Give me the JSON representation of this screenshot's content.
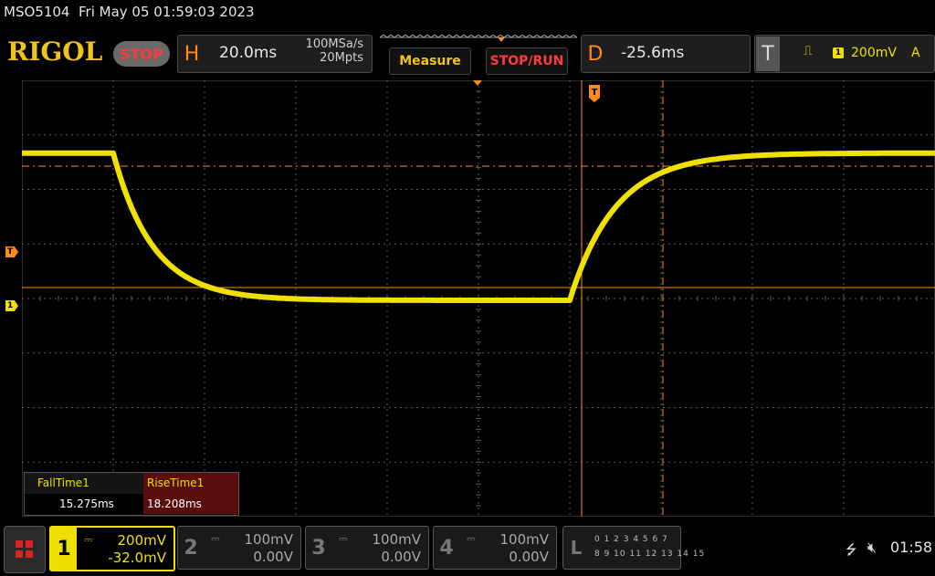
{
  "status": {
    "model": "MSO5104",
    "datetime": "Fri May 05 01:59:03 2023"
  },
  "header": {
    "logo": "RIGOL",
    "run_state": "STOP",
    "horizontal": {
      "letter": "H",
      "timebase": "20.0ms",
      "sample_rate": "100MSa/s",
      "memory_depth": "20Mpts"
    },
    "measure_label": "Measure",
    "stoprun_label": "STOP/RUN",
    "delay": {
      "letter": "D",
      "value": "-25.6ms"
    },
    "trigger": {
      "letter": "T",
      "channel": "1",
      "level": "200mV",
      "mode": "A",
      "edge_icon": "rising-edge-icon"
    }
  },
  "markers": {
    "trigger_level": "T",
    "ch1_ground": "1",
    "trigger_position": "T"
  },
  "measurements": [
    {
      "name": "FallTime1",
      "value": "15.275ms"
    },
    {
      "name": "RiseTime1",
      "value": "18.208ms"
    }
  ],
  "channels": [
    {
      "num": "1",
      "coupling": "DC",
      "scale": "200mV",
      "offset": "-32.0mV",
      "active": true
    },
    {
      "num": "2",
      "coupling": "DC",
      "scale": "100mV",
      "offset": "0.00V",
      "active": false
    },
    {
      "num": "3",
      "coupling": "DC",
      "scale": "100mV",
      "offset": "0.00V",
      "active": false
    },
    {
      "num": "4",
      "coupling": "DC",
      "scale": "100mV",
      "offset": "0.00V",
      "active": false
    }
  ],
  "logic": {
    "letter": "L",
    "row1": "0 1 2 3  4 5 6 7",
    "row2": "8 9 10 11 12 13 14 15"
  },
  "system": {
    "time": "01:58"
  },
  "colors": {
    "ch1": "#f0e000",
    "trigger": "#ff8c1a",
    "grid": "#5a5a5a",
    "accent": "#f0c419"
  },
  "waveform": {
    "channel": "1",
    "description_points_divisions": {
      "high_level_div": 2.7,
      "low_level_div": 0.0,
      "fall_start_div": 1.0,
      "fall_end_div": 3.0,
      "rise_start_div": 6.0,
      "rise_end_div": 8.0
    }
  }
}
